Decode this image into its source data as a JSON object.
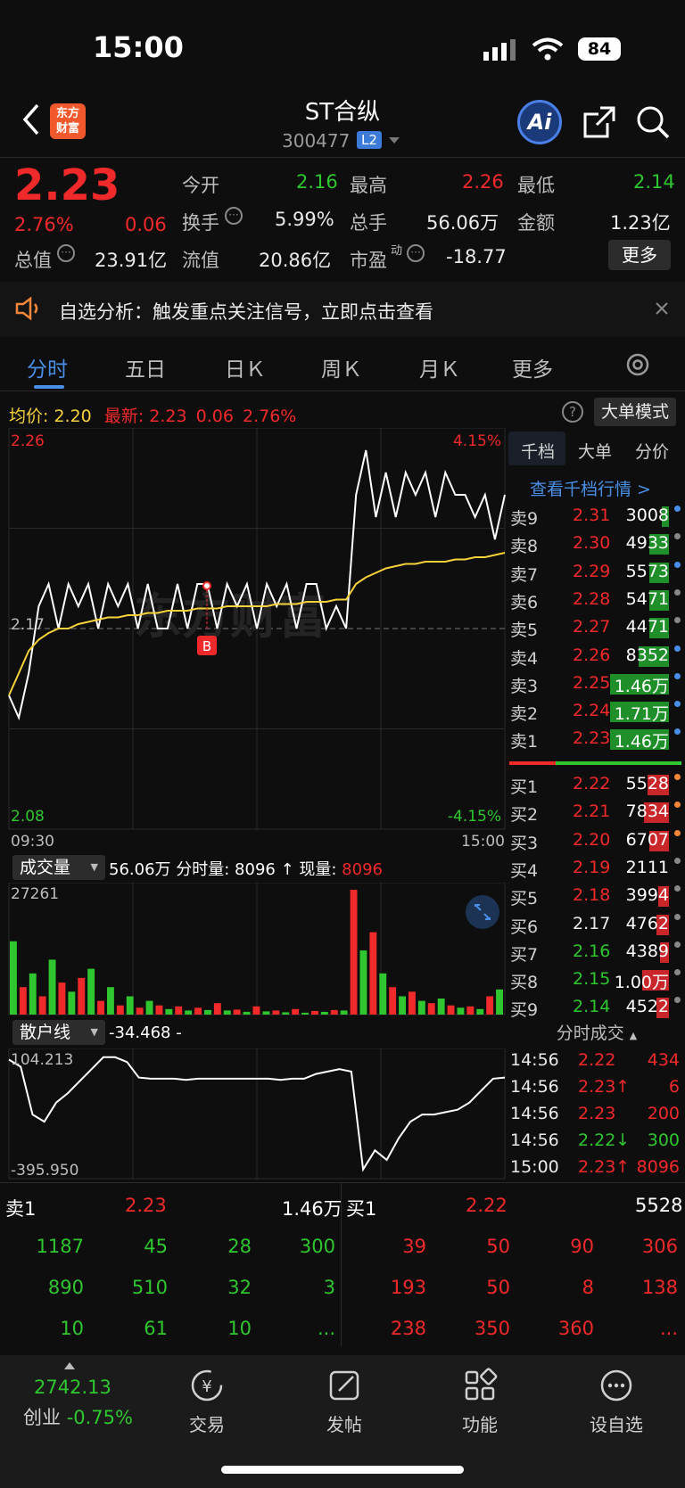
{
  "status_bar": {
    "time": "15:00",
    "battery": "84"
  },
  "header": {
    "logo": "东方\n财富",
    "logo_line1": "东方",
    "logo_line2": "财富",
    "stock_name": "ST合纵",
    "stock_code": "300477",
    "level_badge": "L2",
    "ai_label": "Ai"
  },
  "quote": {
    "price": "2.23",
    "change_pct": "2.76%",
    "change": "0.06",
    "open_label": "今开",
    "open": "2.16",
    "high_label": "最高",
    "high": "2.26",
    "low_label": "最低",
    "low": "2.14",
    "turnover_label": "换手",
    "turnover": "5.99%",
    "volume_label": "总手",
    "volume": "56.06万",
    "amount_label": "金额",
    "amount": "1.23亿",
    "mktcap_label": "总值",
    "mktcap": "23.91亿",
    "float_label": "流值",
    "float": "20.86亿",
    "pe_label": "市盈",
    "pe_sup": "动",
    "pe": "-18.77",
    "more_label": "更多"
  },
  "banner": {
    "text": "自选分析：触发重点关注信号，立即点击查看"
  },
  "tabs": [
    "分时",
    "五日",
    "日Ｋ",
    "周Ｋ",
    "月Ｋ",
    "更多"
  ],
  "chart_info": {
    "avg_label": "均价:",
    "avg": "2.20",
    "latest_label": "最新:",
    "latest": "2.23",
    "change": "0.06",
    "change_pct": "2.76%",
    "bigorder_label": "大单模式"
  },
  "chart_data": [
    {
      "type": "line",
      "ylim": [
        2.08,
        2.26
      ],
      "y_tick_labels": {
        "top": "2.26",
        "mid": "2.17",
        "bottom": "2.08",
        "top_right": "4.15%",
        "bottom_right": "-4.15%"
      },
      "x_tick_labels": [
        "09:30",
        "15:00"
      ],
      "series": [
        {
          "name": "price",
          "color": "#ffffff",
          "values": [
            2.14,
            2.13,
            2.15,
            2.18,
            2.19,
            2.17,
            2.19,
            2.18,
            2.19,
            2.17,
            2.19,
            2.18,
            2.19,
            2.17,
            2.19,
            2.17,
            2.17,
            2.19,
            2.17,
            2.19,
            2.19,
            2.17,
            2.19,
            2.18,
            2.19,
            2.17,
            2.19,
            2.18,
            2.19,
            2.17,
            2.19,
            2.19,
            2.17,
            2.18,
            2.17,
            2.23,
            2.25,
            2.22,
            2.24,
            2.22,
            2.24,
            2.23,
            2.24,
            2.22,
            2.24,
            2.23,
            2.23,
            2.22,
            2.23,
            2.21,
            2.23
          ]
        },
        {
          "name": "avg",
          "color": "#f5d23b",
          "values": [
            2.14,
            2.15,
            2.16,
            2.165,
            2.168,
            2.17,
            2.17,
            2.172,
            2.173,
            2.174,
            2.175,
            2.175,
            2.176,
            2.176,
            2.177,
            2.177,
            2.178,
            2.178,
            2.178,
            2.179,
            2.179,
            2.179,
            2.18,
            2.18,
            2.18,
            2.18,
            2.18,
            2.181,
            2.181,
            2.181,
            2.182,
            2.182,
            2.182,
            2.183,
            2.183,
            2.19,
            2.193,
            2.195,
            2.197,
            2.198,
            2.199,
            2.199,
            2.2,
            2.2,
            2.2,
            2.201,
            2.201,
            2.202,
            2.202,
            2.203,
            2.204
          ]
        }
      ]
    },
    {
      "type": "bar",
      "title": "成交量",
      "y_tick_labels": [
        "27261"
      ],
      "info": "56.06万 分时量: 8096 ↑ 现量:",
      "current_volume": "8096",
      "values": [
        16000,
        6000,
        9000,
        4000,
        12000,
        7000,
        5000,
        8000,
        10000,
        3000,
        6000,
        2000,
        4000,
        1500,
        3000,
        2000,
        1200,
        1800,
        900,
        1500,
        1000,
        2500,
        900,
        1100,
        600,
        1800,
        700,
        900,
        500,
        1200,
        400,
        800,
        600,
        1000,
        900,
        27261,
        14000,
        18000,
        9000,
        6000,
        4000,
        5000,
        3000,
        2500,
        3500,
        2000,
        1500,
        1800,
        1200,
        4000,
        5500
      ]
    },
    {
      "type": "line",
      "title": "散户线",
      "current": "-34.468 -",
      "y_tick_labels": [
        "104.213",
        "-395.950"
      ],
      "values": [
        80,
        50,
        -150,
        -180,
        -100,
        -60,
        -10,
        40,
        90,
        90,
        70,
        5,
        0,
        0,
        0,
        -5,
        0,
        0,
        0,
        0,
        0,
        0,
        0,
        -5,
        0,
        0,
        20,
        30,
        40,
        30,
        -380,
        -300,
        -340,
        -250,
        -180,
        -150,
        -150,
        -140,
        -130,
        -100,
        -50,
        0,
        5
      ]
    }
  ],
  "order_book": {
    "tabs": [
      "千档",
      "大单",
      "分价"
    ],
    "link": "查看千档行情 >",
    "sells": [
      {
        "label": "卖9",
        "price": "2.31",
        "vol": "3008",
        "color": "red"
      },
      {
        "label": "卖8",
        "price": "2.30",
        "vol": "4933",
        "color": "red"
      },
      {
        "label": "卖7",
        "price": "2.29",
        "vol": "5573",
        "color": "red"
      },
      {
        "label": "卖6",
        "price": "2.28",
        "vol": "5471",
        "color": "red"
      },
      {
        "label": "卖5",
        "price": "2.27",
        "vol": "4471",
        "color": "red"
      },
      {
        "label": "卖4",
        "price": "2.26",
        "vol": "8352",
        "color": "red"
      },
      {
        "label": "卖3",
        "price": "2.25",
        "vol": "1.46万",
        "color": "red"
      },
      {
        "label": "卖2",
        "price": "2.24",
        "vol": "1.71万",
        "color": "red"
      },
      {
        "label": "卖1",
        "price": "2.23",
        "vol": "1.46万",
        "color": "red"
      }
    ],
    "buys": [
      {
        "label": "买1",
        "price": "2.22",
        "vol": "5528",
        "color": "red"
      },
      {
        "label": "买2",
        "price": "2.21",
        "vol": "7834",
        "color": "red"
      },
      {
        "label": "买3",
        "price": "2.20",
        "vol": "6707",
        "color": "red"
      },
      {
        "label": "买4",
        "price": "2.19",
        "vol": "2111",
        "color": "red"
      },
      {
        "label": "买5",
        "price": "2.18",
        "vol": "3994",
        "color": "red"
      },
      {
        "label": "买6",
        "price": "2.17",
        "vol": "4762",
        "color": "white"
      },
      {
        "label": "买7",
        "price": "2.16",
        "vol": "4389",
        "color": "green"
      },
      {
        "label": "买8",
        "price": "2.15",
        "vol": "1.00万",
        "color": "green"
      },
      {
        "label": "买9",
        "price": "2.14",
        "vol": "4522",
        "color": "green"
      }
    ],
    "trades_title": "分时成交",
    "trades": [
      {
        "time": "14:56",
        "price": "2.22",
        "vol": "434"
      },
      {
        "time": "14:56",
        "price": "2.23↑",
        "vol": "6"
      },
      {
        "time": "14:56",
        "price": "2.23",
        "vol": "200"
      },
      {
        "time": "14:56",
        "price": "2.22↓",
        "vol": "300"
      },
      {
        "time": "15:00",
        "price": "2.23↑",
        "vol": "8096"
      }
    ]
  },
  "queue": {
    "sell_label": "卖1",
    "sell_price": "2.23",
    "sell_vol": "1.46万",
    "buy_label": "买1",
    "buy_price": "2.22",
    "buy_vol": "5528",
    "sell_rows": [
      [
        "1187",
        "45",
        "28",
        "300"
      ],
      [
        "890",
        "510",
        "32",
        "3"
      ],
      [
        "10",
        "61",
        "10",
        "..."
      ]
    ],
    "buy_rows": [
      [
        "39",
        "50",
        "90",
        "306"
      ],
      [
        "193",
        "50",
        "8",
        "138"
      ],
      [
        "238",
        "350",
        "360",
        "..."
      ]
    ]
  },
  "bottom_nav": {
    "index_value": "2742.13",
    "index_name": "创业",
    "index_change": "-0.75%",
    "items": [
      "交易",
      "发帖",
      "功能",
      "设自选"
    ]
  }
}
